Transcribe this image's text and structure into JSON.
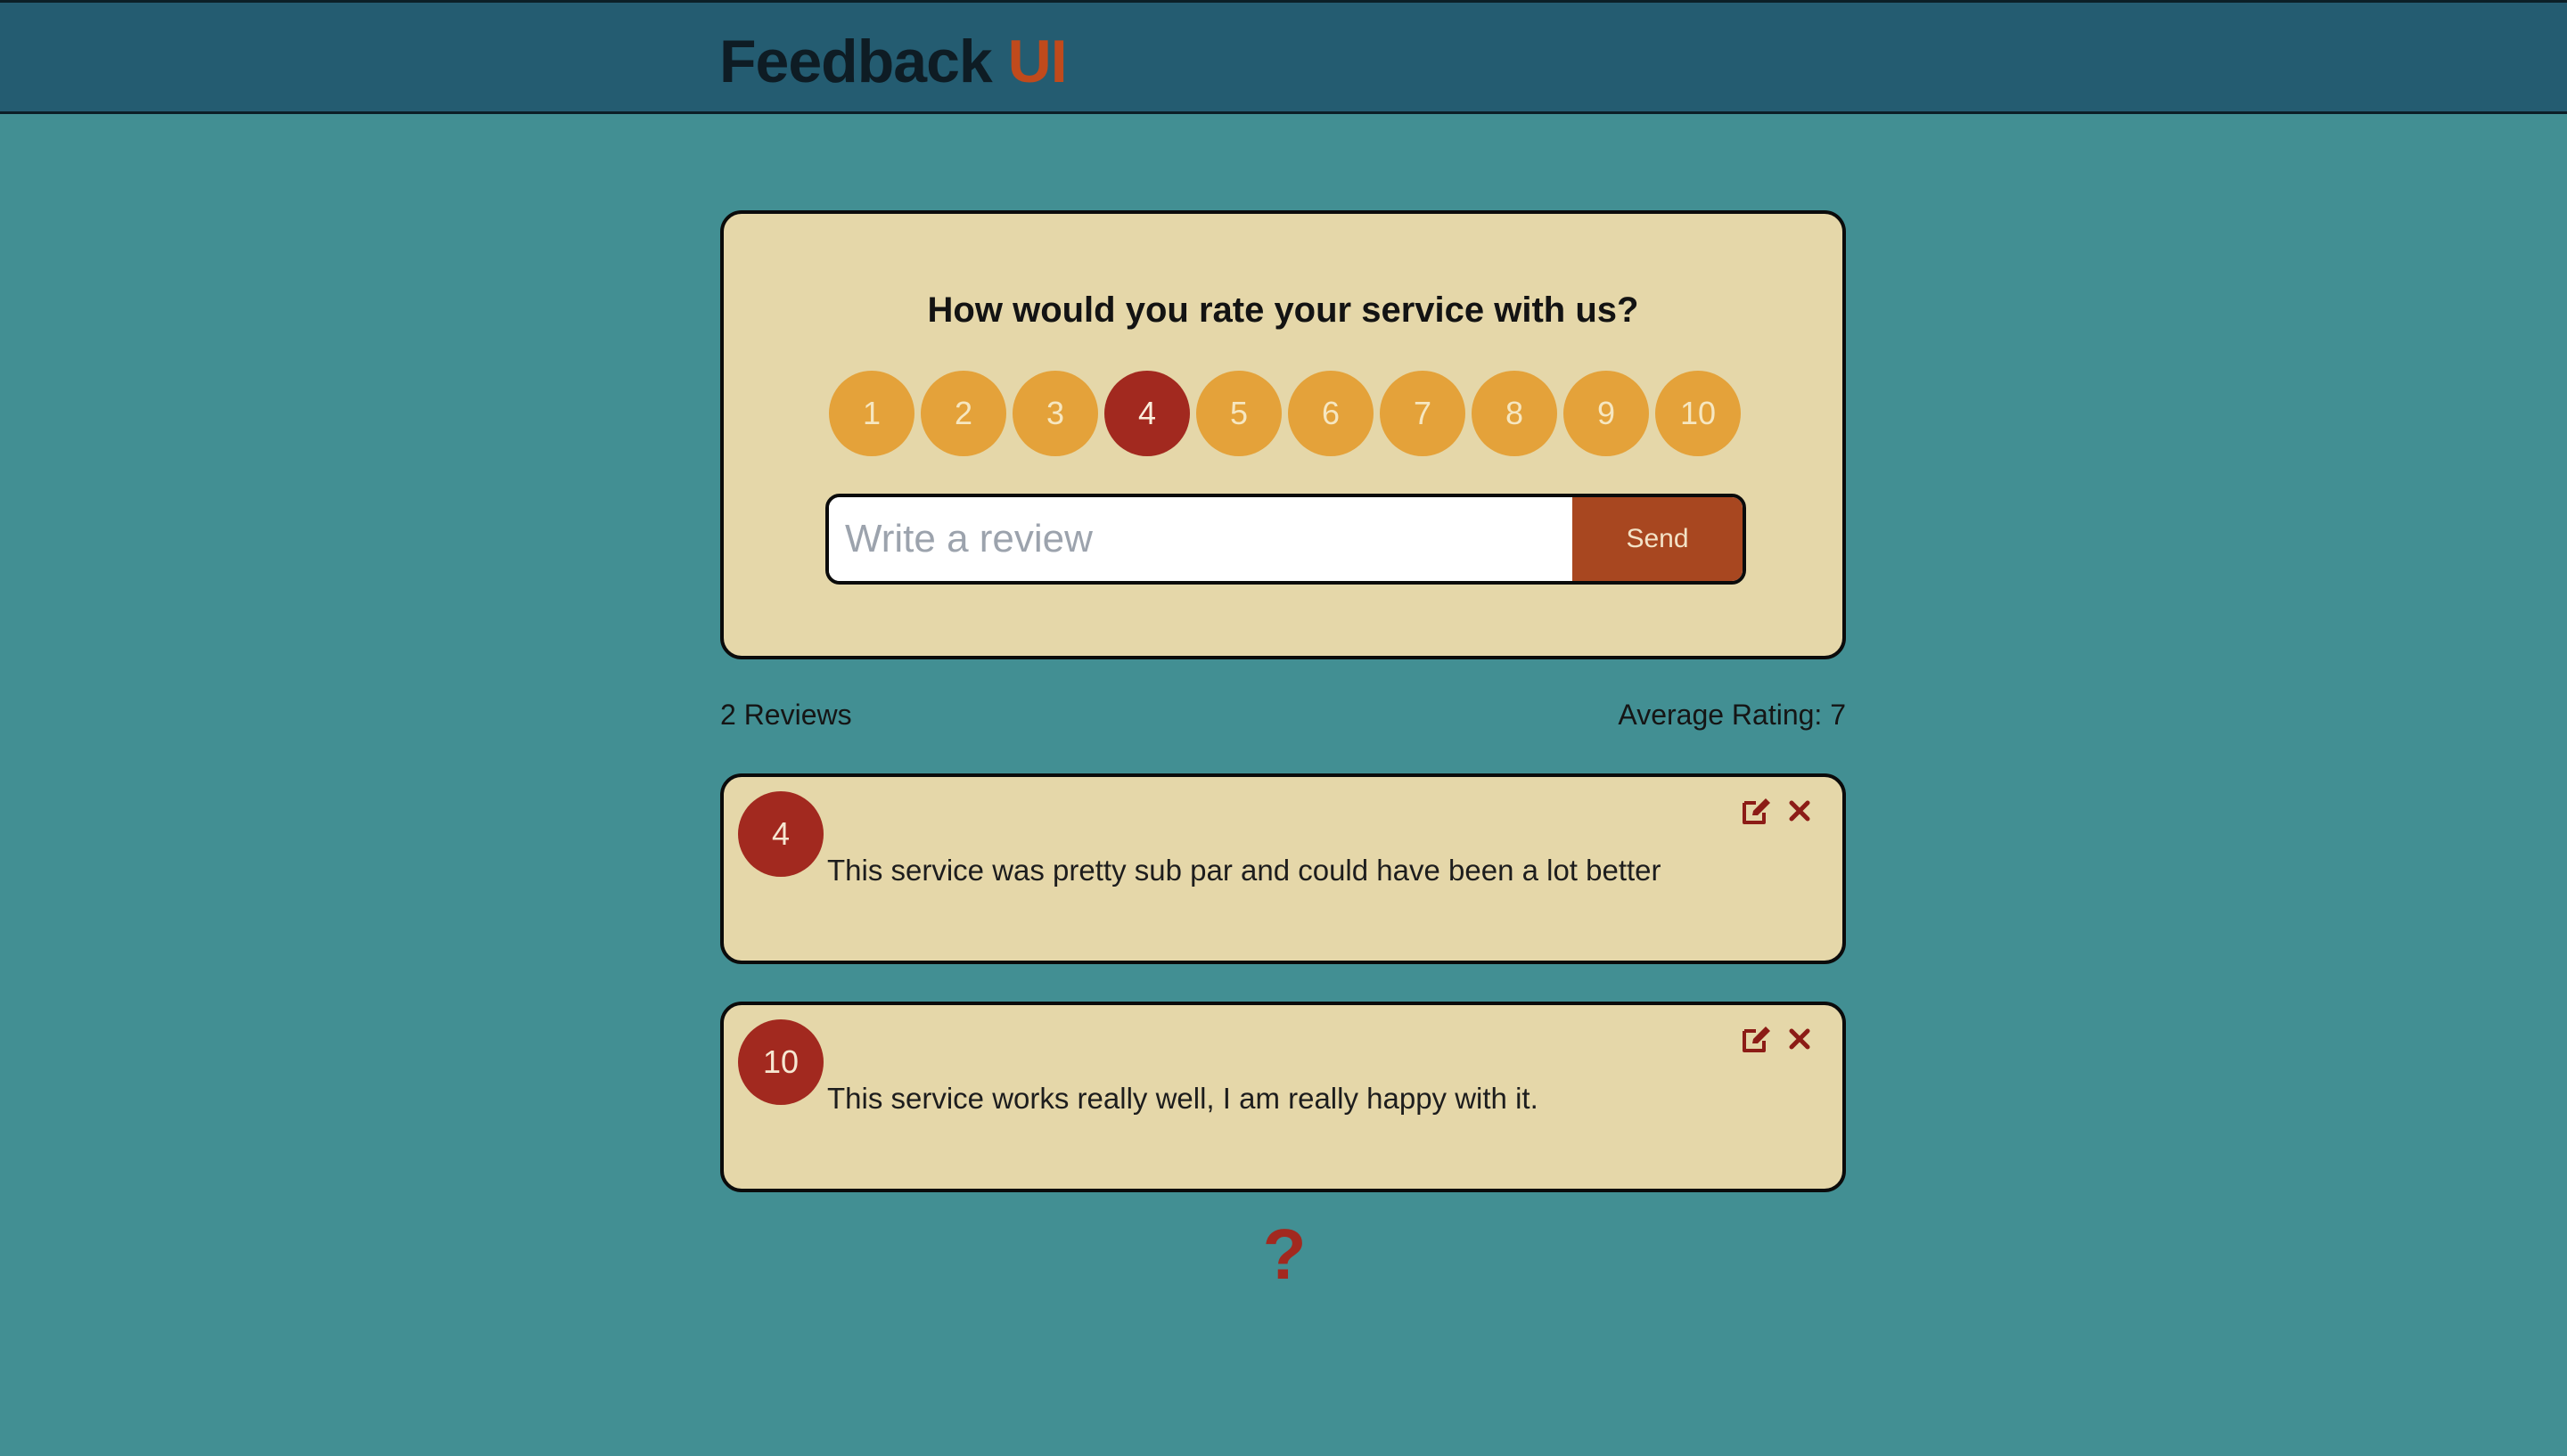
{
  "header": {
    "brand_main": "Feedback",
    "brand_accent": "UI"
  },
  "rating_form": {
    "question": "How would you rate your service with us?",
    "options": [
      "1",
      "2",
      "3",
      "4",
      "5",
      "6",
      "7",
      "8",
      "9",
      "10"
    ],
    "selected": "4",
    "review_placeholder": "Write a review",
    "review_value": "",
    "send_label": "Send"
  },
  "stats": {
    "count_label": "2 Reviews",
    "average_label": "Average Rating: 7"
  },
  "reviews": [
    {
      "rating": "4",
      "text": "This service was pretty sub par and could have been a lot better",
      "edit_icon": "edit-icon",
      "delete_icon": "close-icon"
    },
    {
      "rating": "10",
      "text": "This service works really well, I am really happy with it.",
      "edit_icon": "edit-icon",
      "delete_icon": "close-icon"
    }
  ],
  "footer": {
    "help_icon": "question-icon",
    "help_glyph": "?"
  },
  "colors": {
    "background": "#428f93",
    "header": "#245c71",
    "card": "#e5d7a9",
    "accent_orange": "#e4a23a",
    "selected_red": "#a2291f",
    "send_button": "#a84720",
    "brand_accent": "#c04a1c"
  }
}
